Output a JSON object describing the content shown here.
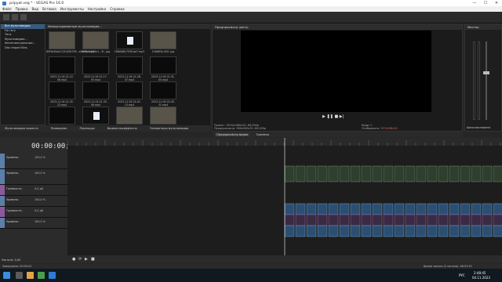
{
  "window": {
    "title": "pripyat.veg * - VEGAS Pro 16.0",
    "minimize": "—",
    "maximize": "☐",
    "close": "✕"
  },
  "menu": [
    "Файл",
    "Правка",
    "Вид",
    "Вставка",
    "Инструменты",
    "Настройка",
    "Справка"
  ],
  "explorer": {
    "header": "Импортированные мультимедиа...",
    "items": [
      "Все мультимедиа",
      "По тегу",
      "Теги",
      "Мультимедиа...",
      "Интеллектуальные...",
      "Disc Import Bins"
    ]
  },
  "media": {
    "items": [
      {
        "label": "89f3b40ab112f2482335...e2fb4c.mp4",
        "kind": "image"
      },
      {
        "label": "b7f4e0-0b8a1...5f...jpg",
        "kind": "image"
      },
      {
        "label": "1f8b0b8c753f1ae7.mp3",
        "kind": "file"
      },
      {
        "label": "1f4b8f3e-000..jpg",
        "kind": "image"
      },
      {
        "label": "2023-11-04 01-12-08.mp4",
        "kind": "black"
      },
      {
        "label": "2023-11-04 01-17-05.mp4",
        "kind": "black"
      },
      {
        "label": "2023-11-04 01-28-47.mp4",
        "kind": "black"
      },
      {
        "label": "2023-11-04 01-31-05.mp4",
        "kind": "black"
      },
      {
        "label": "2023-11-04 01-32-23.mp4",
        "kind": "black"
      },
      {
        "label": "2023-11-04 01-35-06.mp4",
        "kind": "black"
      },
      {
        "label": "2023-11-04 02-41-13.mp4",
        "kind": "black"
      },
      {
        "label": "2023-11-04 02-45-31.mp4",
        "kind": "black"
      },
      {
        "label": "",
        "kind": "black"
      },
      {
        "label": "",
        "kind": "file"
      },
      {
        "label": "",
        "kind": "image"
      },
      {
        "label": "",
        "kind": "image"
      }
    ]
  },
  "tabs": [
    "Мультимедиа проекта",
    "Проводник",
    "Переходы",
    "Видеоспецэффекты",
    "Генераторы мультимедиа"
  ],
  "preview": {
    "header": "Предпросмотр (авто)",
    "info_labels": [
      "Проект:",
      "Предпросмотр:",
      "Кадр:",
      "Отображать:"
    ],
    "info_values": [
      "1920x1080x32; 60,000р",
      "960x540x32; 60,000р",
      "0",
      "597x336x32"
    ],
    "tabs": [
      "Предпросмотр видео",
      "Триммер"
    ]
  },
  "master": {
    "header": "Мастер",
    "footer": "Шина мастеринга"
  },
  "timeline": {
    "timecode": "00:00:00;00",
    "tracks": [
      {
        "name": "Уровень:",
        "value": "100,0 %",
        "color": "#5a7fa8"
      },
      {
        "name": "Уровень:",
        "value": "100,0 %",
        "color": "#5a7fa8"
      },
      {
        "name": "Громкость:",
        "value": "0,0 дБ",
        "color": "#8c5a9a"
      },
      {
        "name": "Уровень:",
        "value": "100,0 %",
        "color": "#5a7fa8"
      },
      {
        "name": "Громкость:",
        "value": "0,0 дБ",
        "color": "#8c5a9a"
      },
      {
        "name": "Уровень:",
        "value": "100,0 %",
        "color": "#5a7fa8"
      }
    ],
    "rate": "Частота: 0,00",
    "ruler_marker": "00:00:35"
  },
  "status": {
    "left": "Завершено: 00:00:02",
    "right": "Время записи (2 канала): 46:53:20"
  },
  "taskbar": {
    "lang": "РУС",
    "time": "2:48:45",
    "date": "04.11.2023"
  },
  "colors": {
    "accent": "#375a7f",
    "video_clip": "#2e3f2e",
    "audio_clip": "#3a2a44",
    "blue_clip": "#2b4f73"
  }
}
